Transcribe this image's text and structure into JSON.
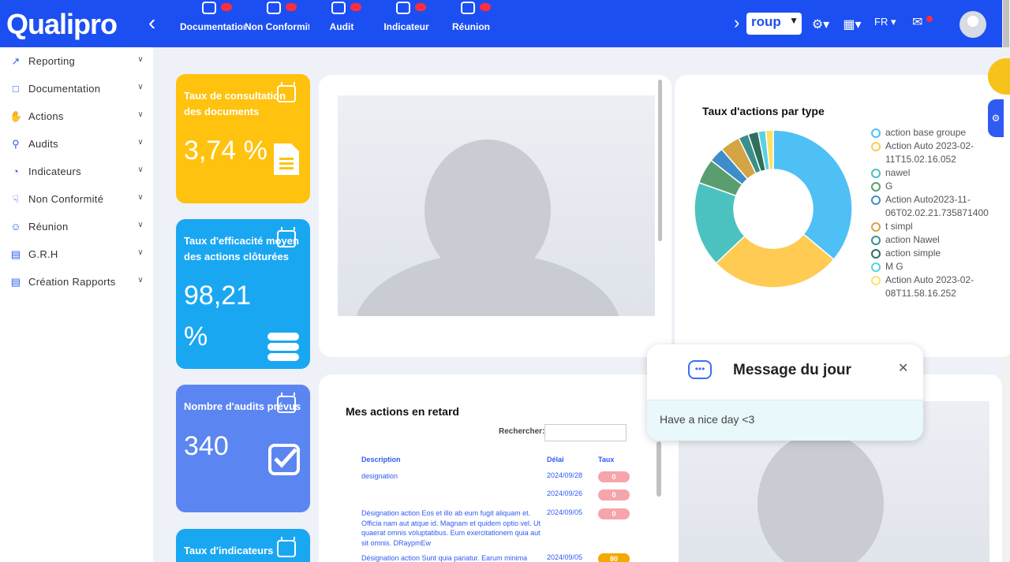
{
  "app": {
    "logo_text": "Qualipro",
    "collapse_icon": "chevron-left-icon"
  },
  "top_modules": [
    {
      "label": "Documentation",
      "icon": "folder-icon"
    },
    {
      "label": "Non Conformité",
      "icon": "warning-icon"
    },
    {
      "label": "Audit",
      "icon": "audit-icon"
    },
    {
      "label": "Indicateur",
      "icon": "gauge-icon"
    },
    {
      "label": "Réunion",
      "icon": "meeting-icon"
    }
  ],
  "header": {
    "group_select_value": "roup",
    "settings_icon": "gear-icon",
    "apps_icon": "grid-icon",
    "language": "FR",
    "notifications_icon": "bell-icon",
    "avatar_icon": "user-avatar-icon"
  },
  "sidebar": {
    "items": [
      {
        "label": "Reporting",
        "icon": "chart-icon"
      },
      {
        "label": "Documentation",
        "icon": "document-icon"
      },
      {
        "label": "Actions",
        "icon": "hand-icon"
      },
      {
        "label": "Audits",
        "icon": "search-doc-icon"
      },
      {
        "label": "Indicateurs",
        "icon": "gauge-icon"
      },
      {
        "label": "Non Conformité",
        "icon": "thumbs-down-icon"
      },
      {
        "label": "Réunion",
        "icon": "people-icon"
      },
      {
        "label": "G.R.H",
        "icon": "id-card-icon"
      },
      {
        "label": "Création Rapports",
        "icon": "report-icon"
      }
    ]
  },
  "stat_cards": [
    {
      "title": "Taux de consultation des documents",
      "value": "3,74 %",
      "color": "#ffc20e",
      "icon": "document-icon"
    },
    {
      "title": "Taux d'efficacité moyen des actions clôturées",
      "value": "98,21 %",
      "color": "#1aa7f2",
      "icon": "database-icon"
    },
    {
      "title": "Nombre d'audits prévus",
      "value": "340",
      "color": "#5b85f0",
      "icon": "checkbox-icon"
    },
    {
      "title": "Taux d'indicateurs",
      "value": "",
      "color": "#1aa7f2",
      "icon": "calendar-icon"
    }
  ],
  "chart_data": {
    "type": "pie",
    "title": "Taux d'actions par type",
    "categories": [
      "action base groupe",
      "Action Auto 2023-02-11T15.02.16.052",
      "nawel",
      "G",
      "Action Auto2023-11-06T02.02.21.735871400",
      "t simpl",
      "action Nawel",
      "action simple",
      "M G",
      "Action Auto 2023-02-08T11.58.16.252"
    ],
    "values": [
      35,
      26,
      17,
      5,
      3,
      4,
      2,
      2,
      1.5,
      1.5
    ],
    "colors": [
      "#4fc0f5",
      "#ffcb52",
      "#4bc2c0",
      "#5a9e6f",
      "#3e8dca",
      "#d5a545",
      "#3b8f8a",
      "#2f6f5e",
      "#5ad0e6",
      "#ffe066"
    ],
    "legend_position": "right",
    "donut": true
  },
  "table": {
    "title": "Mes actions en retard",
    "search_label": "Rechercher:",
    "columns": [
      "Description",
      "Délai",
      "Taux"
    ],
    "rows": [
      {
        "description": "designation",
        "date": "2024/09/28",
        "rate": "0",
        "rate_color": "pink"
      },
      {
        "description": "",
        "date": "2024/09/26",
        "rate": "0",
        "rate_color": "pink"
      },
      {
        "description": "Désignation action Eos et illo ab eum fugit aliquam et. Officia nam aut atque id. Magnam et quidem optio vel. Ut quaerat omnis voluptatibus. Eum exercitationem quia aut sit omnis. DRaypmEw",
        "date": "2024/09/05",
        "rate": "0",
        "rate_color": "pink"
      },
      {
        "description": "Désignation action Sunt quia pariatur. Earum minima",
        "date": "2024/09/05",
        "rate": "80",
        "rate_color": "orange"
      }
    ]
  },
  "modal": {
    "title": "Message du jour",
    "message": "Have a nice day <3",
    "icon": "chat-bubble-icon",
    "close_icon": "close-icon"
  }
}
